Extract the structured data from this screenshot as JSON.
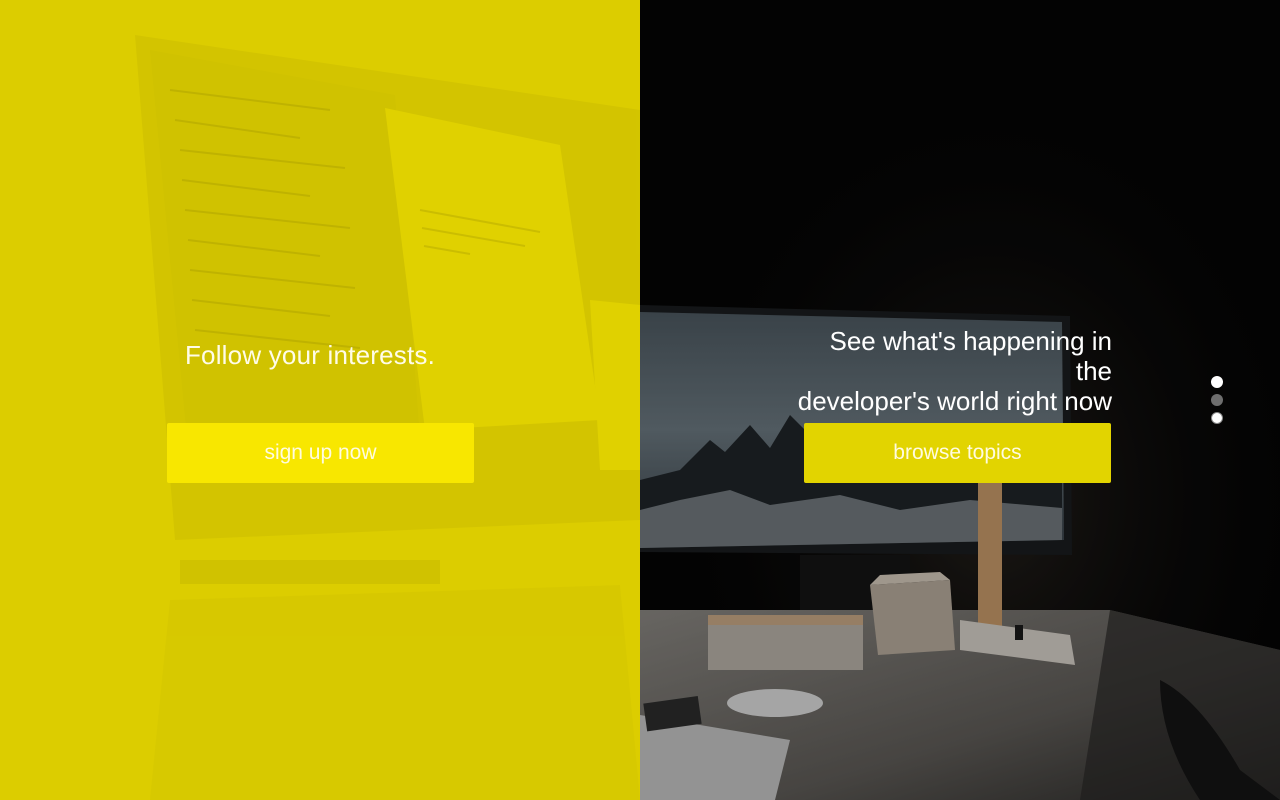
{
  "left": {
    "headline": "Follow your interests.",
    "cta_label": "sign up now"
  },
  "right": {
    "headline_line1": "See what's happening in the",
    "headline_line2": "developer's world right now",
    "cta_label": "browse topics"
  },
  "pagination": {
    "count": 3,
    "active_index": 0
  },
  "colors": {
    "left_overlay": "#dccd00",
    "left_button": "#f8e700",
    "right_button": "#e2d400",
    "right_bg": "#050505"
  }
}
